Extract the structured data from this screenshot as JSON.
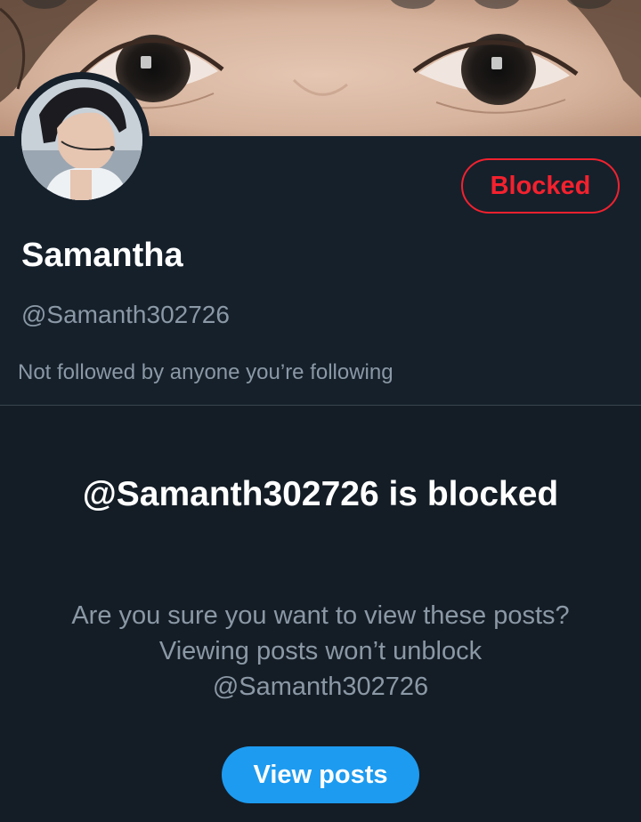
{
  "profile": {
    "display_name": "Samantha",
    "handle": "@Samanth302726",
    "followed_by": "Not followed by anyone you’re following",
    "blocked_label": "Blocked"
  },
  "blocked_notice": {
    "title": "@Samanth302726 is blocked",
    "description": "Are you sure you want to view these posts? Viewing posts won’t unblock @Samanth302726",
    "view_posts_label": "View posts"
  },
  "colors": {
    "background": "#15202b",
    "blocked_red": "#f4212e",
    "accent_blue": "#1d9bf0",
    "secondary_text": "#8b98a5"
  }
}
